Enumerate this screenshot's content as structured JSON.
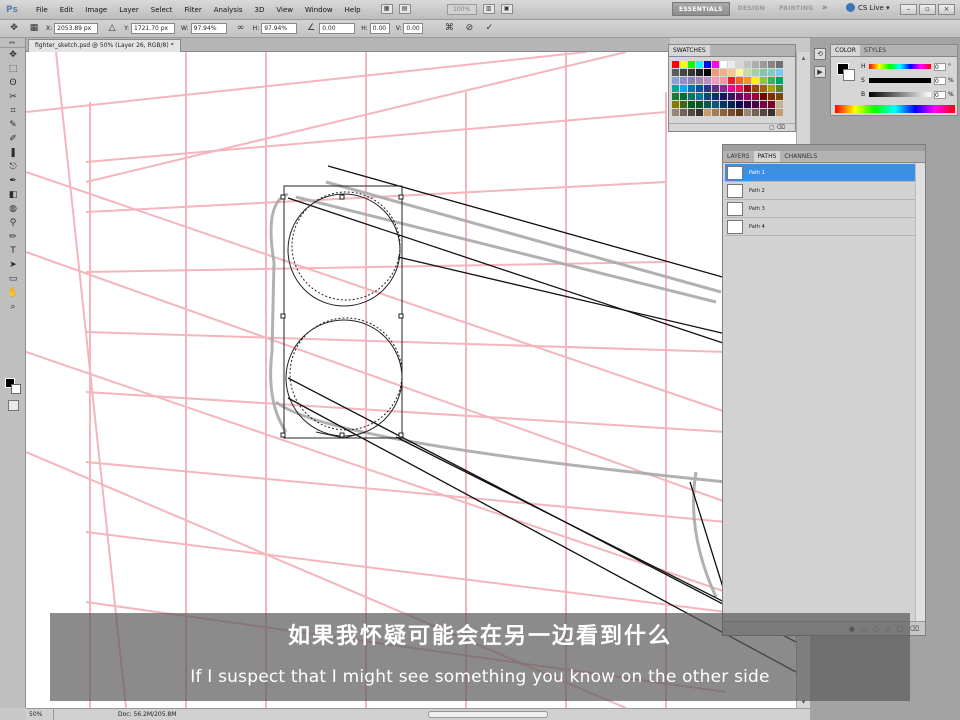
{
  "app": {
    "logo": "Ps",
    "menu": [
      "File",
      "Edit",
      "Image",
      "Layer",
      "Select",
      "Filter",
      "Analysis",
      "3D",
      "View",
      "Window",
      "Help"
    ],
    "zoom_level": "100%",
    "workspaces": [
      "ESSENTIALS",
      "DESIGN",
      "PAINTING"
    ],
    "workspaces_more": "»",
    "cs_live": "CS Live ▾",
    "window_buttons": [
      "–",
      "▫",
      "×"
    ]
  },
  "options_bar": {
    "x_label": "X:",
    "x_value": "2053.89 px",
    "y_label": "Y:",
    "y_value": "1721.70 px",
    "w_label": "W:",
    "w_value": "97.94%",
    "h_label": "H:",
    "h_value": "97.94%",
    "angle_value": "0.00",
    "hskew_label": "H:",
    "hskew_value": "0.00",
    "vskew_label": "V:",
    "vskew_value": "0.00",
    "cancel_icon": "⊘",
    "commit_icon": "✓"
  },
  "document": {
    "tab_title": "fighter_sketch.psd @ 50% (Layer 26, RGB/8) *"
  },
  "tools": [
    "✥",
    "⬚",
    "ʘ",
    "✂",
    "⌗",
    "✎",
    "✐",
    "❚",
    "⎋",
    "✒",
    "◧",
    "◍",
    "⚲",
    "✏",
    "T",
    "➤",
    "▭",
    "✋",
    "⌕"
  ],
  "status": {
    "zoom": "50%",
    "doc": "Doc: 56.2M/205.8M"
  },
  "swatches_panel": {
    "tab": "SWATCHES",
    "colors": [
      "#ff0000",
      "#ffff00",
      "#00ff00",
      "#00ffff",
      "#0000ff",
      "#ff00ff",
      "#ffffff",
      "#ebebeb",
      "#d6d6d6",
      "#c2c2c2",
      "#adadad",
      "#999999",
      "#858585",
      "#707070",
      "#5c5c5c",
      "#474747",
      "#333333",
      "#1f1f1f",
      "#000000",
      "#f7977a",
      "#f9ad81",
      "#fdc68a",
      "#fff79a",
      "#c4df9b",
      "#a3d39c",
      "#82ca9d",
      "#7bcdc8",
      "#6ecff6",
      "#7ea7d8",
      "#8493ca",
      "#8882be",
      "#a187be",
      "#bc8dbf",
      "#f49ac2",
      "#f6989d",
      "#ed1c24",
      "#f26522",
      "#f7941d",
      "#fff200",
      "#8dc73f",
      "#39b54a",
      "#00a651",
      "#00a99d",
      "#00aeef",
      "#0072bc",
      "#0054a6",
      "#2e3192",
      "#662d91",
      "#92278f",
      "#ec008c",
      "#ed145b",
      "#9e0b0f",
      "#a0410d",
      "#a36209",
      "#aba000",
      "#598527",
      "#197b30",
      "#007236",
      "#00746b",
      "#0076a3",
      "#004b80",
      "#003471",
      "#1b1464",
      "#440e62",
      "#630460",
      "#9e005d",
      "#9e0039",
      "#790000",
      "#7b2e00",
      "#7d4900",
      "#827b00",
      "#406618",
      "#005e20",
      "#005826",
      "#005952",
      "#005b7f",
      "#003663",
      "#002157",
      "#0d004c",
      "#32004b",
      "#4b0049",
      "#7b0046",
      "#7a0026",
      "#c7b299",
      "#998675",
      "#736357",
      "#534741",
      "#37302d",
      "#c69c6d",
      "#a67c52",
      "#8c6239",
      "#754c24",
      "#603913",
      "#998675",
      "#736357",
      "#534741",
      "#37302d",
      "#c69c6d"
    ],
    "footer": "▢ ⌫"
  },
  "color_panel": {
    "tabs": [
      "COLOR",
      "STYLES"
    ],
    "channels": [
      {
        "label": "H",
        "value": "0",
        "unit": "°"
      },
      {
        "label": "S",
        "value": "0",
        "unit": "%"
      },
      {
        "label": "B",
        "value": "0",
        "unit": "%"
      }
    ]
  },
  "paths_panel": {
    "tabs": [
      "LAYERS",
      "PATHS",
      "CHANNELS"
    ],
    "paths": [
      "Path 1",
      "Path 2",
      "Path 3",
      "Path 4"
    ],
    "selected_index": 0,
    "footer_icons": [
      "●",
      "○",
      "◌",
      "◇",
      "▢",
      "⌫"
    ]
  },
  "subtitles": {
    "cn": "如果我怀疑可能会在另一边看到什么",
    "en": "If I suspect that I might see something you know on the other side"
  }
}
